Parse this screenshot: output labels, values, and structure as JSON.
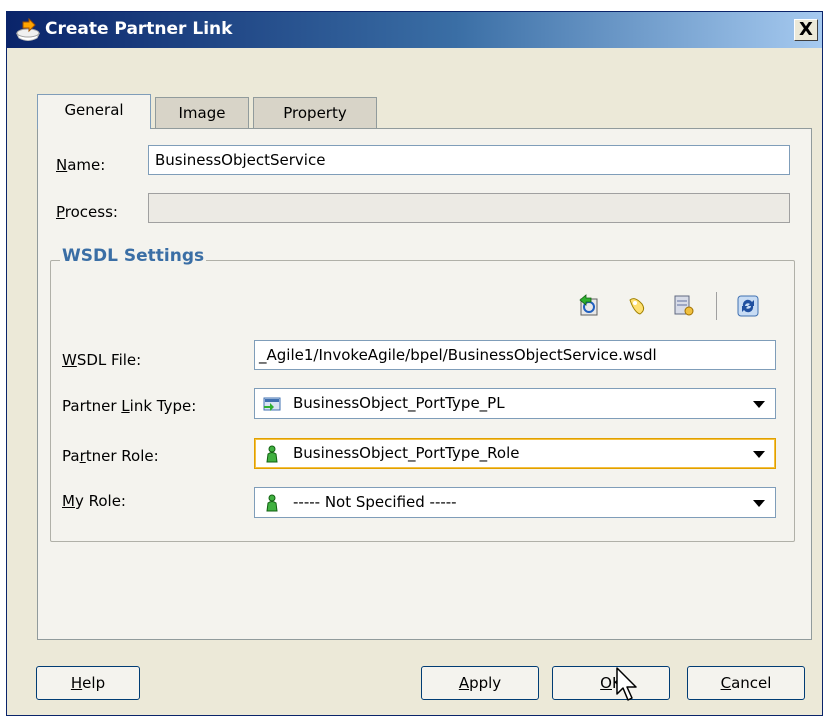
{
  "dialog": {
    "title": "Create Partner Link",
    "close_label": "X"
  },
  "tabs": [
    {
      "pre": "",
      "key": "",
      "post": "General"
    },
    {
      "pre": "",
      "key": "",
      "post": "Image"
    },
    {
      "pre": "",
      "key": "",
      "post": "Property"
    }
  ],
  "form": {
    "name": {
      "key": "N",
      "rest": "ame:",
      "value": "BusinessObjectService"
    },
    "process": {
      "key": "P",
      "rest": "rocess:",
      "value": ""
    }
  },
  "wsdl": {
    "title": "WSDL Settings",
    "file": {
      "key": "W",
      "rest": "SDL File:",
      "value": "_Agile1/InvokeAgile/bpel/BusinessObjectService.wsdl"
    },
    "partner_link_type": {
      "pre": "Partner ",
      "key": "L",
      "post": "ink Type:",
      "value": "BusinessObject_PortType_PL"
    },
    "partner_role": {
      "pre": "Pa",
      "key": "r",
      "post": "tner Role:",
      "value": "BusinessObject_PortType_Role"
    },
    "my_role": {
      "pre": "",
      "key": "M",
      "post": "y Role:",
      "value": "----- Not Specified -----"
    }
  },
  "buttons": {
    "help": {
      "key": "H",
      "rest": "elp"
    },
    "apply": {
      "key": "A",
      "rest": "pply"
    },
    "ok": {
      "key": "O",
      "rest": "K"
    },
    "cancel": {
      "key": "C",
      "rest": "ancel"
    }
  },
  "colors": {
    "title_gradient_start": "#0a246a",
    "title_gradient_end": "#a6caf0",
    "group_title": "#3a6ea5",
    "focus_border": "#e0a000"
  }
}
